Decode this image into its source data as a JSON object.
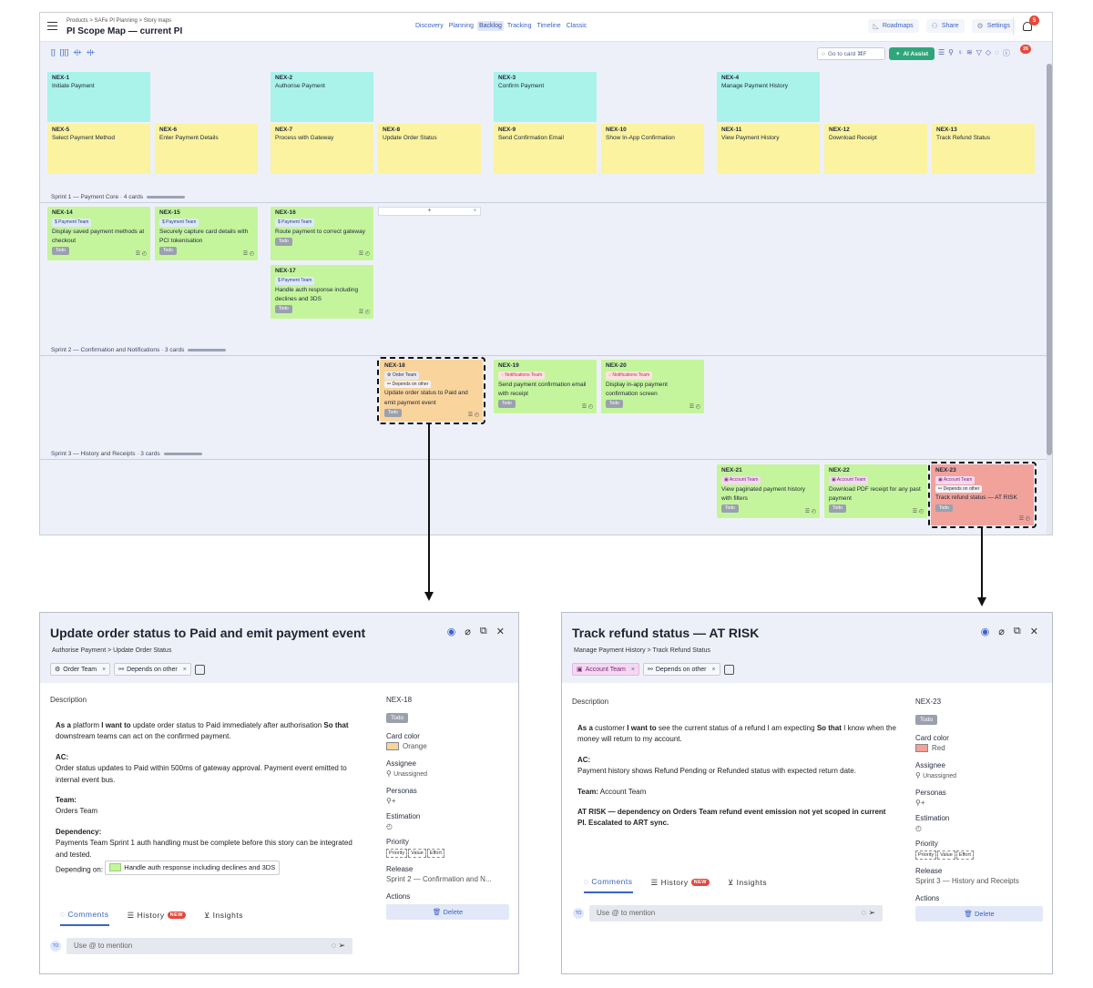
{
  "header": {
    "breadcrumb": "Products > SAFe PI Planning > Story maps",
    "title": "PI Scope Map — current PI",
    "view_tabs": [
      "Discovery",
      "Planning",
      "Backlog",
      "Tracking",
      "Timeline",
      "Classic"
    ],
    "active_tab": "Backlog",
    "roadmaps": "Roadmaps",
    "share": "Share",
    "settings": "Settings",
    "notif_count": "5"
  },
  "toolbar": {
    "goto_placeholder": "Go to card ⌘F",
    "ai_assist": "AI Assist",
    "filter_count": "26"
  },
  "epics": [
    {
      "key": "NEX-1",
      "title": "Initiate Payment"
    },
    {
      "key": "NEX-2",
      "title": "Authorise Payment"
    },
    {
      "key": "NEX-3",
      "title": "Confirm Payment"
    },
    {
      "key": "NEX-4",
      "title": "Manage Payment History"
    }
  ],
  "features": [
    {
      "key": "NEX-5",
      "title": "Select Payment Method"
    },
    {
      "key": "NEX-6",
      "title": "Enter Payment Details"
    },
    {
      "key": "NEX-7",
      "title": "Process with Gateway"
    },
    {
      "key": "NEX-8",
      "title": "Update Order Status"
    },
    {
      "key": "NEX-9",
      "title": "Send Confirmation Email"
    },
    {
      "key": "NEX-10",
      "title": "Show In-App Confirmation"
    },
    {
      "key": "NEX-11",
      "title": "View Payment History"
    },
    {
      "key": "NEX-12",
      "title": "Download Receipt"
    },
    {
      "key": "NEX-13",
      "title": "Track Refund Status"
    }
  ],
  "sprints": [
    {
      "label": "Sprint 1 — Payment Core · 4 cards"
    },
    {
      "label": "Sprint 2 — Confirmation and Notifications · 3 cards"
    },
    {
      "label": "Sprint 3 — History and Receipts · 3 cards"
    }
  ],
  "stories": [
    {
      "key": "NEX-14",
      "team": "Payment Team",
      "title": "Display saved payment methods at checkout",
      "status": "Todo"
    },
    {
      "key": "NEX-15",
      "team": "Payment Team",
      "title": "Securely capture card details with PCI tokenisation",
      "status": "Todo"
    },
    {
      "key": "NEX-16",
      "team": "Payment Team",
      "title": "Route payment to correct gateway",
      "status": "Todo"
    },
    {
      "key": "NEX-17",
      "team": "Payment Team",
      "title": "Handle auth response including declines and 3DS",
      "status": "Todo"
    },
    {
      "key": "NEX-18",
      "team": "Order Team",
      "dep": "Depends on other",
      "title": "Update order status to Paid and emit payment event",
      "status": "Todo"
    },
    {
      "key": "NEX-19",
      "team": "Notifications Team",
      "title": "Send payment confirmation email with receipt",
      "status": "Todo"
    },
    {
      "key": "NEX-20",
      "team": "Notifications Team",
      "title": "Display in-app payment confirmation screen",
      "status": "Todo"
    },
    {
      "key": "NEX-21",
      "team": "Account Team",
      "title": "View paginated payment history with filters",
      "status": "Todo"
    },
    {
      "key": "NEX-22",
      "team": "Account Team",
      "title": "Download PDF receipt for any past payment",
      "status": "Todo"
    },
    {
      "key": "NEX-23",
      "team": "Account Team",
      "dep": "Depends on other",
      "title": "Track refund status — AT RISK",
      "status": "Todo"
    }
  ],
  "panel_left": {
    "title": "Update order status to Paid and emit payment event",
    "path": "Authorise Payment > Update Order Status",
    "tag_team": "Order Team",
    "tag_dep": "Depends on other",
    "description_label": "Description",
    "as_a": "As a",
    "as_a_text": " platform ",
    "i_want_to": "I want to",
    "i_want_text": " update order status to Paid immediately after authorisation",
    "so_that": "So that",
    "so_that_text": " downstream teams can act on the confirmed payment.",
    "ac_label": "AC:",
    "ac_text": "Order status updates to Paid within 500ms of gateway approval. Payment event emitted to internal event bus.",
    "team_label": "Team:",
    "team_text": "Orders Team",
    "dependency_label": "Dependency:",
    "dependency_text": "Payments Team Sprint 1 auth handling must be complete before this story can be integrated and tested.",
    "depending_on": "Depending on:",
    "depending_card": "Handle auth response including declines and 3DS",
    "key": "NEX-18",
    "status": "Todo",
    "card_color_label": "Card color",
    "card_color": "Orange",
    "assignee_label": "Assignee",
    "assignee": "Unassigned",
    "personas_label": "Personas",
    "estimation_label": "Estimation",
    "priority_label": "Priority",
    "priority_chips": [
      "Priority",
      "Value",
      "Effort"
    ],
    "release_label": "Release",
    "release": "Sprint 2 — Confirmation and N...",
    "actions_label": "Actions",
    "delete": "Delete",
    "tabs": {
      "comments": "Comments",
      "history": "History",
      "new": "NEW",
      "insights": "Insights"
    },
    "comment_placeholder": "Use @ to mention",
    "avatar": "TO"
  },
  "panel_right": {
    "title": "Track refund status — AT RISK",
    "path": "Manage Payment History > Track Refund Status",
    "tag_team": "Account Team",
    "tag_dep": "Depends on other",
    "description_label": "Description",
    "as_a": "As a",
    "as_a_text": " customer ",
    "i_want_to": "I want to",
    "i_want_text": " see the current status of a refund I am expecting ",
    "so_that": "So that",
    "so_that_text": " I know when the money will return to my account.",
    "ac_label": "AC:",
    "ac_text": "Payment history shows Refund Pending or Refunded status with expected return date.",
    "team_label": "Team:",
    "team_text": " Account Team",
    "at_risk_text": "AT RISK — dependency on Orders Team refund event emission not yet scoped in current PI. Escalated to ART sync.",
    "key": "NEX-23",
    "status": "Todo",
    "card_color_label": "Card color",
    "card_color": "Red",
    "assignee_label": "Assignee",
    "assignee": "Unassigned",
    "personas_label": "Personas",
    "estimation_label": "Estimation",
    "priority_label": "Priority",
    "priority_chips": [
      "Priority",
      "Value",
      "Effort"
    ],
    "release_label": "Release",
    "release": "Sprint 3 — History and Receipts",
    "actions_label": "Actions",
    "delete": "Delete",
    "tabs": {
      "comments": "Comments",
      "history": "History",
      "new": "NEW",
      "insights": "Insights"
    },
    "comment_placeholder": "Use @ to mention",
    "avatar": "TO"
  },
  "colors": {
    "epic": "#a9f3ea",
    "feature": "#fbf39f",
    "story": "#c4f59c",
    "orange": "#f9d49c",
    "red": "#f0a29b",
    "accent": "#3b62c7"
  }
}
